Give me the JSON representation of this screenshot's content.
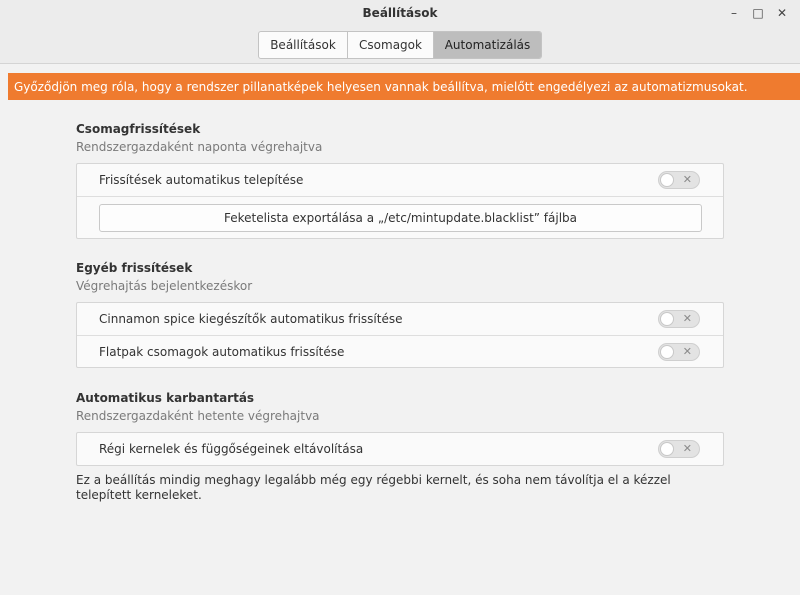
{
  "window": {
    "title": "Beállítások",
    "controls": {
      "minimize": "–",
      "maximize": "□",
      "close": "✕"
    }
  },
  "tabs": [
    {
      "label": "Beállítások",
      "active": false
    },
    {
      "label": "Csomagok",
      "active": false
    },
    {
      "label": "Automatizálás",
      "active": true
    }
  ],
  "warning": {
    "text": "Győződjön meg róla, hogy a rendszer pillanatképek helyesen vannak beállítva, mielőtt engedélyezi az automatizmusokat.",
    "color": "#ef7b2f"
  },
  "sections": {
    "package_updates": {
      "title": "Csomagfrissítések",
      "subtitle": "Rendszergazdaként naponta végrehajtva",
      "auto_install": {
        "label": "Frissítések automatikus telepítése",
        "enabled": false
      },
      "export_button": "Feketelista exportálása a „/etc/mintupdate.blacklist” fájlba"
    },
    "other_updates": {
      "title": "Egyéb frissítések",
      "subtitle": "Végrehajtás bejelentkezéskor",
      "cinnamon_spices": {
        "label": "Cinnamon spice kiegészítők automatikus frissítése",
        "enabled": false
      },
      "flatpak": {
        "label": "Flatpak csomagok automatikus frissítése",
        "enabled": false
      }
    },
    "maintenance": {
      "title": "Automatikus karbantartás",
      "subtitle": "Rendszergazdaként hetente végrehajtva",
      "remove_kernels": {
        "label": "Régi kernelek és függőségeinek eltávolítása",
        "enabled": false
      },
      "note": "Ez a beállítás mindig meghagy legalább még egy régebbi kernelt, és soha nem távolítja el a kézzel telepített kerneleket."
    }
  },
  "switch_off_symbol": "✕"
}
